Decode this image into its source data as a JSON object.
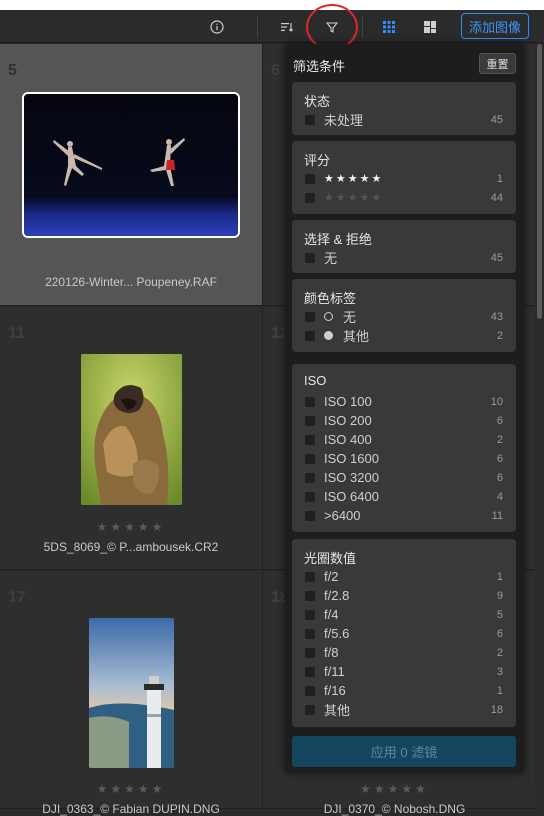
{
  "toolbar": {
    "add_image_label": "添加图像",
    "icons": [
      "info-icon",
      "sort-icon",
      "filter-icon",
      "grid-view-icon",
      "mosaic-view-icon"
    ],
    "accent": "#2f8cff"
  },
  "grid": {
    "cells": [
      {
        "number": "5",
        "name": "220126-Winter... Poupeney.RAF",
        "stars": ""
      },
      {
        "number": "6",
        "name": "",
        "stars": ""
      },
      {
        "number": "11",
        "name": "5DS_8069_© P...ambousek.CR2",
        "stars": "★★★★★"
      },
      {
        "number": "12",
        "name": "",
        "stars": ""
      },
      {
        "number": "17",
        "name": "DJI_0363_© Fabian DUPIN.DNG",
        "stars": "★★★★★"
      },
      {
        "number": "18",
        "name": "DJI_0370_© Nobosh.DNG",
        "stars": "★★★★★"
      }
    ]
  },
  "filter_panel": {
    "title": "筛选条件",
    "reset_label": "重置",
    "apply_label": "应用 0 滤镜",
    "sections": [
      {
        "title": "状态",
        "items": [
          {
            "label": "未处理",
            "count": "45"
          }
        ]
      },
      {
        "title": "评分",
        "items": [
          {
            "label": "★★★★★",
            "count": "1"
          },
          {
            "label": "★★★★★",
            "count": "44"
          }
        ]
      },
      {
        "title": "选择 & 拒绝",
        "items": [
          {
            "label": "无",
            "count": "45"
          }
        ]
      },
      {
        "title": "颜色标签",
        "items": [
          {
            "label": "无",
            "count": "43"
          },
          {
            "label": "其他",
            "count": "2"
          }
        ]
      },
      {
        "title": "ISO",
        "items": [
          {
            "label": "ISO 100",
            "count": "10"
          },
          {
            "label": "ISO 200",
            "count": "6"
          },
          {
            "label": "ISO 400",
            "count": "2"
          },
          {
            "label": "ISO 1600",
            "count": "6"
          },
          {
            "label": "ISO 3200",
            "count": "6"
          },
          {
            "label": "ISO 6400",
            "count": "4"
          },
          {
            "label": ">6400",
            "count": "11"
          }
        ]
      },
      {
        "title": "光圈数值",
        "items": [
          {
            "label": "f/2",
            "count": "1"
          },
          {
            "label": "f/2.8",
            "count": "9"
          },
          {
            "label": "f/4",
            "count": "5"
          },
          {
            "label": "f/5.6",
            "count": "6"
          },
          {
            "label": "f/8",
            "count": "2"
          },
          {
            "label": "f/11",
            "count": "3"
          },
          {
            "label": "f/16",
            "count": "1"
          },
          {
            "label": "其他",
            "count": "18"
          }
        ]
      }
    ]
  }
}
